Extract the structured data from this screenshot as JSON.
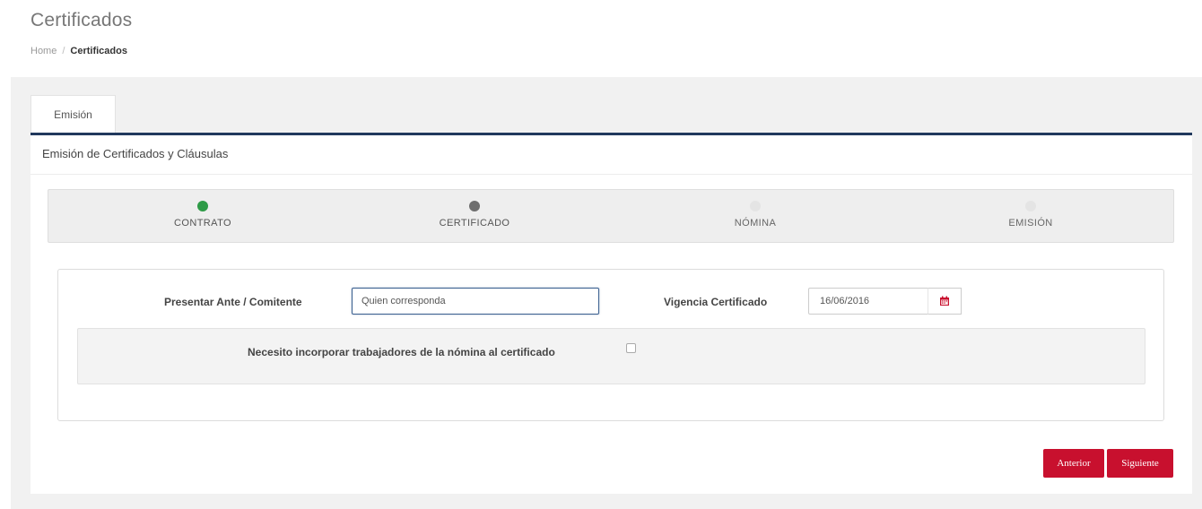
{
  "header": {
    "title": "Certificados",
    "breadcrumb": {
      "home": "Home",
      "separator": "/",
      "current": "Certificados"
    }
  },
  "tabs": [
    {
      "label": "Emisión",
      "active": true
    }
  ],
  "panel": {
    "heading": "Emisión de Certificados y Cláusulas"
  },
  "wizard": {
    "steps": [
      {
        "label": "CONTRATO",
        "state": "completed",
        "color": "#2e9b47"
      },
      {
        "label": "CERTIFICADO",
        "state": "current",
        "color": "#6e6e6e"
      },
      {
        "label": "NÓMINA",
        "state": "pending",
        "color": "#e4e4e4"
      },
      {
        "label": "EMISIÓN",
        "state": "pending",
        "color": "#e4e4e4"
      }
    ]
  },
  "form": {
    "presentar_label": "Presentar Ante / Comitente",
    "presentar_value": "Quien corresponda",
    "vigencia_label": "Vigencia Certificado",
    "vigencia_value": "16/06/2016",
    "calendar_icon": "calendar-icon",
    "nomina_checkbox_label": "Necesito incorporar trabajadores de la nómina al certificado",
    "nomina_checked": false
  },
  "actions": {
    "prev_label": "Anterior",
    "next_label": "Siguiente"
  },
  "colors": {
    "accent": "#c8102e",
    "tab_underline": "#21395d",
    "step_done": "#2e9b47",
    "step_current": "#6e6e6e",
    "step_pending": "#e4e4e4"
  }
}
